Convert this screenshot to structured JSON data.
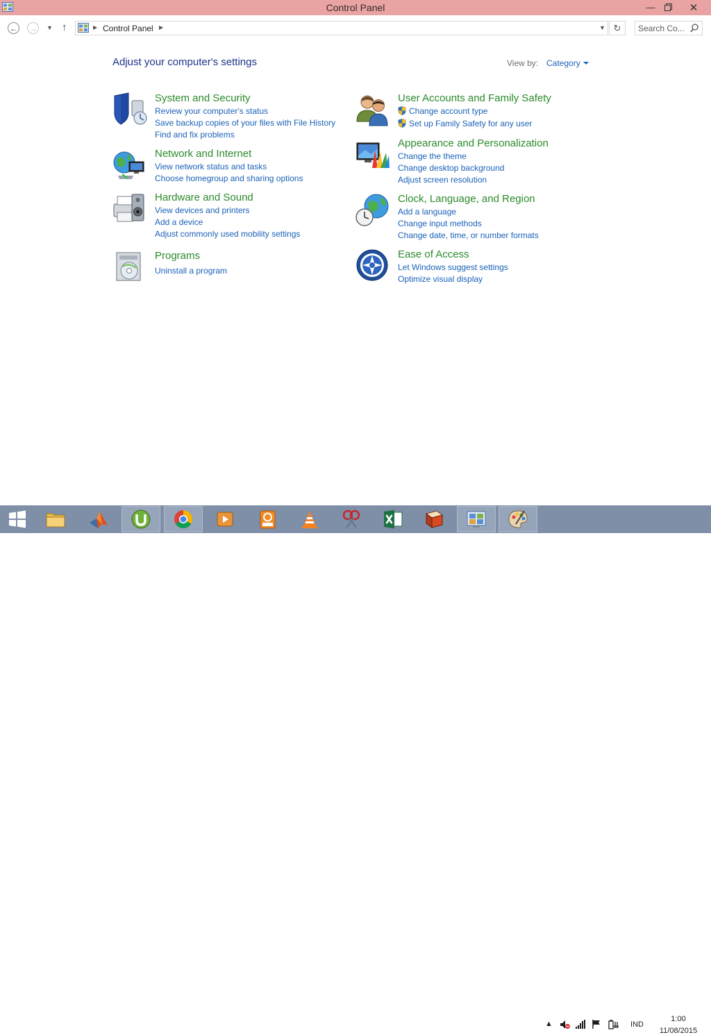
{
  "window": {
    "title": "Control Panel"
  },
  "navigation": {
    "breadcrumb": [
      "Control Panel"
    ],
    "search_placeholder": "Search Co..."
  },
  "header": {
    "title": "Adjust your computer's settings",
    "view_by_label": "View by:",
    "view_by_value": "Category"
  },
  "categories": {
    "system_security": {
      "title": "System and Security",
      "icon": "shield-icon",
      "links": [
        "Review your computer's status",
        "Save backup copies of your files with File History",
        "Find and fix problems"
      ]
    },
    "network_internet": {
      "title": "Network and Internet",
      "icon": "network-globe-icon",
      "links": [
        "View network status and tasks",
        "Choose homegroup and sharing options"
      ]
    },
    "hardware_sound": {
      "title": "Hardware and Sound",
      "icon": "printer-speaker-icon",
      "links": [
        "View devices and printers",
        "Add a device",
        "Adjust commonly used mobility settings"
      ]
    },
    "programs": {
      "title": "Programs",
      "icon": "programs-disc-icon",
      "links": [
        "Uninstall a program"
      ]
    },
    "user_accounts": {
      "title": "User Accounts and Family Safety",
      "icon": "users-icon",
      "links": [
        "Change account type",
        "Set up Family Safety for any user"
      ]
    },
    "appearance": {
      "title": "Appearance and Personalization",
      "icon": "monitor-palette-icon",
      "links": [
        "Change the theme",
        "Change desktop background",
        "Adjust screen resolution"
      ]
    },
    "clock_region": {
      "title": "Clock, Language, and Region",
      "icon": "clock-globe-icon",
      "links": [
        "Add a language",
        "Change input methods",
        "Change date, time, or number formats"
      ]
    },
    "ease_access": {
      "title": "Ease of Access",
      "icon": "ease-of-access-icon",
      "links": [
        "Let Windows suggest settings",
        "Optimize visual display"
      ]
    }
  },
  "taskbar": {
    "apps": [
      "start",
      "file-explorer",
      "matlab",
      "utorrent",
      "chrome",
      "media-player",
      "pdf-reader",
      "vlc",
      "snipping-tool",
      "excel",
      "book-reader",
      "control-panel",
      "paint"
    ],
    "tray": {
      "language": "IND",
      "time": "1:00",
      "date": "11/08/2015"
    }
  },
  "colors": {
    "titlebar": "#e9a3a3",
    "category_title": "#2b8a2b",
    "link": "#1a61b8",
    "page_title": "#1e3287",
    "taskbar": "#7f8fa8"
  }
}
